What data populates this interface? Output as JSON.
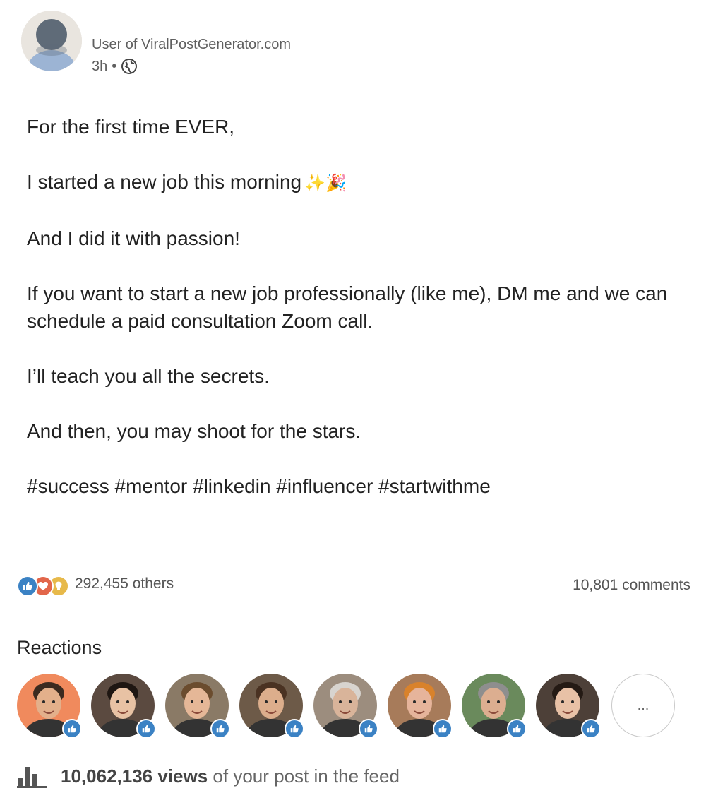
{
  "header": {
    "author_name": "User of ViralPostGenerator.com",
    "time_ago": "3h",
    "separator": "•",
    "visibility_icon": "globe-icon"
  },
  "post": {
    "paragraphs": [
      "For the first time EVER,",
      "I started a new job this morning",
      "And I did it with passion!",
      "If you want to start a new job professionally (like me), DM me and we can schedule a paid consultation Zoom call.",
      "I’ll teach you all the secrets.",
      "And then, you may shoot for the stars.",
      "#success #mentor #linkedin #influencer #startwithme"
    ],
    "emoji": "✨🎉"
  },
  "social": {
    "reaction_icons": [
      "like-icon",
      "love-icon",
      "insightful-icon"
    ],
    "others": "292,455 others",
    "comments": "10,801 comments"
  },
  "reactions": {
    "title": "Reactions",
    "more_label": "...",
    "reactors": [
      {
        "bg": "#f08a5d",
        "skin": "#e3b08b",
        "hair": "#3b2a1f"
      },
      {
        "bg": "#5b4a40",
        "skin": "#e8c2a4",
        "hair": "#1e1612"
      },
      {
        "bg": "#8a7a66",
        "skin": "#e5b797",
        "hair": "#6b4c2e"
      },
      {
        "bg": "#6d5a48",
        "skin": "#dcae8c",
        "hair": "#4a3222"
      },
      {
        "bg": "#9c8d7e",
        "skin": "#d9b49a",
        "hair": "#d8d4cf"
      },
      {
        "bg": "#a77b5a",
        "skin": "#e6b49b",
        "hair": "#d9822b"
      },
      {
        "bg": "#6a8a5c",
        "skin": "#dcae90",
        "hair": "#8e8e8e"
      },
      {
        "bg": "#4d4038",
        "skin": "#e8c1a6",
        "hair": "#241a14"
      }
    ]
  },
  "views": {
    "count": "10,062,136 views",
    "suffix": " of your post in the feed"
  },
  "colors": {
    "like": "#3b82c4",
    "love": "#e2664a",
    "insightful": "#e7b94a",
    "text_primary": "#222222",
    "text_secondary": "#5f5f5f"
  }
}
